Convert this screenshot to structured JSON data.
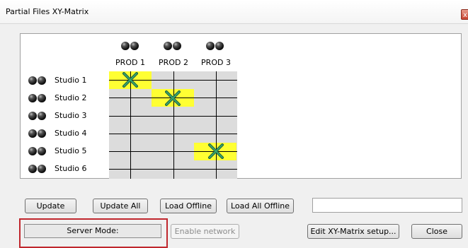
{
  "window": {
    "title": "Partial Files XY-Matrix",
    "close_glyph": "x"
  },
  "matrix": {
    "columns": [
      "PROD 1",
      "PROD 2",
      "PROD 3"
    ],
    "rows": [
      "Studio 1",
      "Studio 2",
      "Studio 3",
      "Studio 4",
      "Studio 5",
      "Studio 6"
    ],
    "connections": [
      {
        "row": "Studio 1",
        "column": "PROD 1"
      },
      {
        "row": "Studio 2",
        "column": "PROD 2"
      },
      {
        "row": "Studio 5",
        "column": "PROD 3"
      }
    ],
    "highlight_color": "#ffff33",
    "grid_fill": "#dcdcdc",
    "marker_color": "#2e8b57",
    "icons": {
      "source": "status-dots-icon",
      "connection": "cross-marker-icon"
    }
  },
  "buttons": {
    "update": "Update",
    "update_all": "Update All",
    "load_offline": "Load Offline",
    "load_all_offline": "Load All Offline",
    "enable_network": "Enable network",
    "edit_setup": "Edit XY-Matrix setup...",
    "close": "Close"
  },
  "status": {
    "server_mode_label": "Server Mode:",
    "text_value": "",
    "highlight_frame_color": "#c0272d"
  }
}
